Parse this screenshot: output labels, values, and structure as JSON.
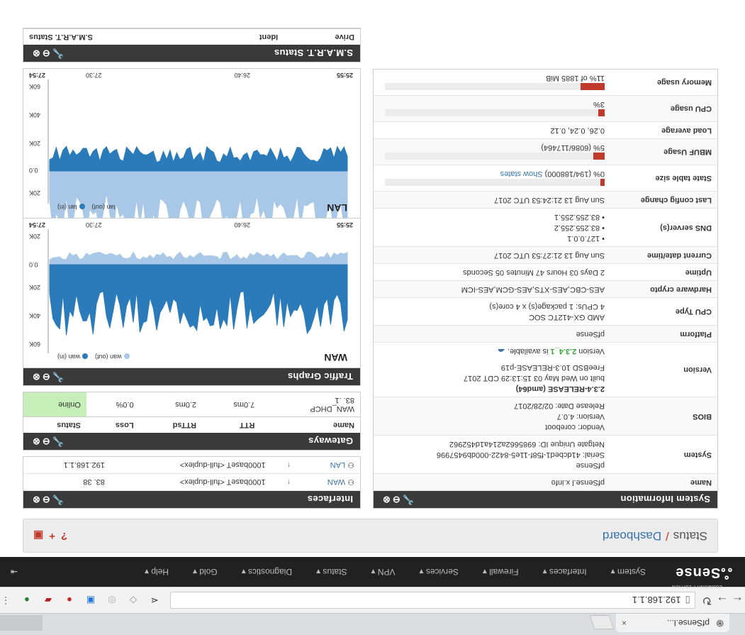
{
  "browser": {
    "tab_title": "pfSense.l...",
    "tab_close": "×",
    "address": "192.168.1.1",
    "page_icon": "page-icon"
  },
  "topnav": {
    "brand_small": "COMMUNITY EDITION",
    "brand": "Sense",
    "menu": [
      "System ▾",
      "Interfaces ▾",
      "Firewall ▾",
      "Services ▾",
      "VPN ▾",
      "Status ▾",
      "Diagnostics ▾",
      "Gold ▾",
      "Help ▾"
    ],
    "logout": "⇥"
  },
  "breadcrumb": {
    "part1": "Status",
    "sep": "/",
    "part2": "Dashboard"
  },
  "system_info": {
    "title": "System Information",
    "rows": {
      "name_k": "Name",
      "name_v": "pfSense.l        x.info",
      "system_k": "System",
      "system_v1": "pfSense",
      "system_v2": "Serial: 41dcbed1-f58f-11e5-8422-000db9457996",
      "system_v3": "Netgate Unique ID: 6985662a214a1d452962",
      "bios_k": "BIOS",
      "bios_v1": "Vendor: coreboot",
      "bios_v2": "Version: 4.0.7",
      "bios_v3": "Release Date: 02/28/2017",
      "version_k": "Version",
      "version_v1": "2.3.4-RELEASE (amd64)",
      "version_v2": "built on Wed May 03 15:13:29 CDT 2017",
      "version_v3": "FreeBSD 10.3-RELEASE-p19",
      "version_v4a": "Version ",
      "version_v4b": "2.3.4_1",
      "version_v4c": " is available.",
      "platform_k": "Platform",
      "platform_v": "pfSense",
      "cputype_k": "CPU Type",
      "cputype_v1": "AMD GX-412TC SOC",
      "cputype_v2": "4 CPUs: 1 package(s) x 4 core(s)",
      "crypto_k": "Hardware crypto",
      "crypto_v": "AES-CBC,AES-XTS,AES-GCM,AES-ICM",
      "uptime_k": "Uptime",
      "uptime_v": "2 Days 03 Hours 47 Minutes 05 Seconds",
      "datetime_k": "Current date/time",
      "datetime_v": "Sun Aug 13 21:27:53 UTC 2017",
      "dns_k": "DNS server(s)",
      "dns_v1": "127.0.0.1",
      "dns_v2": "83.255.255.2",
      "dns_v3": "83.255.255.1",
      "lastcfg_k": "Last config change",
      "lastcfg_v": "Sun Aug 13 21:24:53 UTC 2017",
      "state_k": "State table size",
      "state_v": "0% (194/188000) ",
      "state_link": "Show states",
      "state_pct": 0.001,
      "mbuf_k": "MBUF Usage",
      "mbuf_v": "5% (6086/117464)",
      "mbuf_pct": 0.05,
      "load_k": "Load average",
      "load_v": "0.26, 0.24, 0.12",
      "cpu_k": "CPU usage",
      "cpu_v": "3%",
      "cpu_pct": 0.03,
      "mem_k": "Memory usage",
      "mem_v": "11% of 1885 MiB",
      "mem_pct": 0.11
    }
  },
  "interfaces": {
    "title": "Interfaces",
    "rows": [
      {
        "name": "WAN",
        "media": "1000baseT <full-duplex>",
        "ip": "83.           38"
      },
      {
        "name": "LAN",
        "media": "1000baseT <full-duplex>",
        "ip": "192.168.1.1"
      }
    ]
  },
  "gateways": {
    "title": "Gateways",
    "headers": [
      "Name",
      "RTT",
      "RTTsd",
      "Loss",
      "Status"
    ],
    "row": {
      "name": "WAN_DHCP",
      "ip": "83.         .1",
      "rtt": "7.0ms",
      "rttsd": "2.0ms",
      "loss": "0.0%",
      "status": "Online"
    }
  },
  "traffic": {
    "title": "Traffic Graphs",
    "wan": {
      "label": "WAN",
      "legend_in": "wan (in)",
      "legend_out": "wan (out)",
      "times": [
        "25:55",
        "26:40",
        "27:30",
        "27:54"
      ],
      "yticks": [
        "60K",
        "40K",
        "20K",
        "0.0",
        "20K"
      ]
    },
    "lan": {
      "label": "LAN",
      "legend_in": "lan (in)",
      "legend_out": "lan (out)",
      "times": [
        "25:55",
        "26:40",
        "27:30",
        "27:54"
      ],
      "yticks": [
        "20K",
        "0.0",
        "20K",
        "40K",
        "60K"
      ]
    },
    "colors": {
      "in": "#2b7bba",
      "out": "#a9c8e8"
    }
  },
  "smart": {
    "title": "S.M.A.R.T. Status",
    "headers": [
      "Drive",
      "Ident",
      "S.M.A.R.T. Status"
    ]
  },
  "panel_controls": "🔧⊖⊗"
}
